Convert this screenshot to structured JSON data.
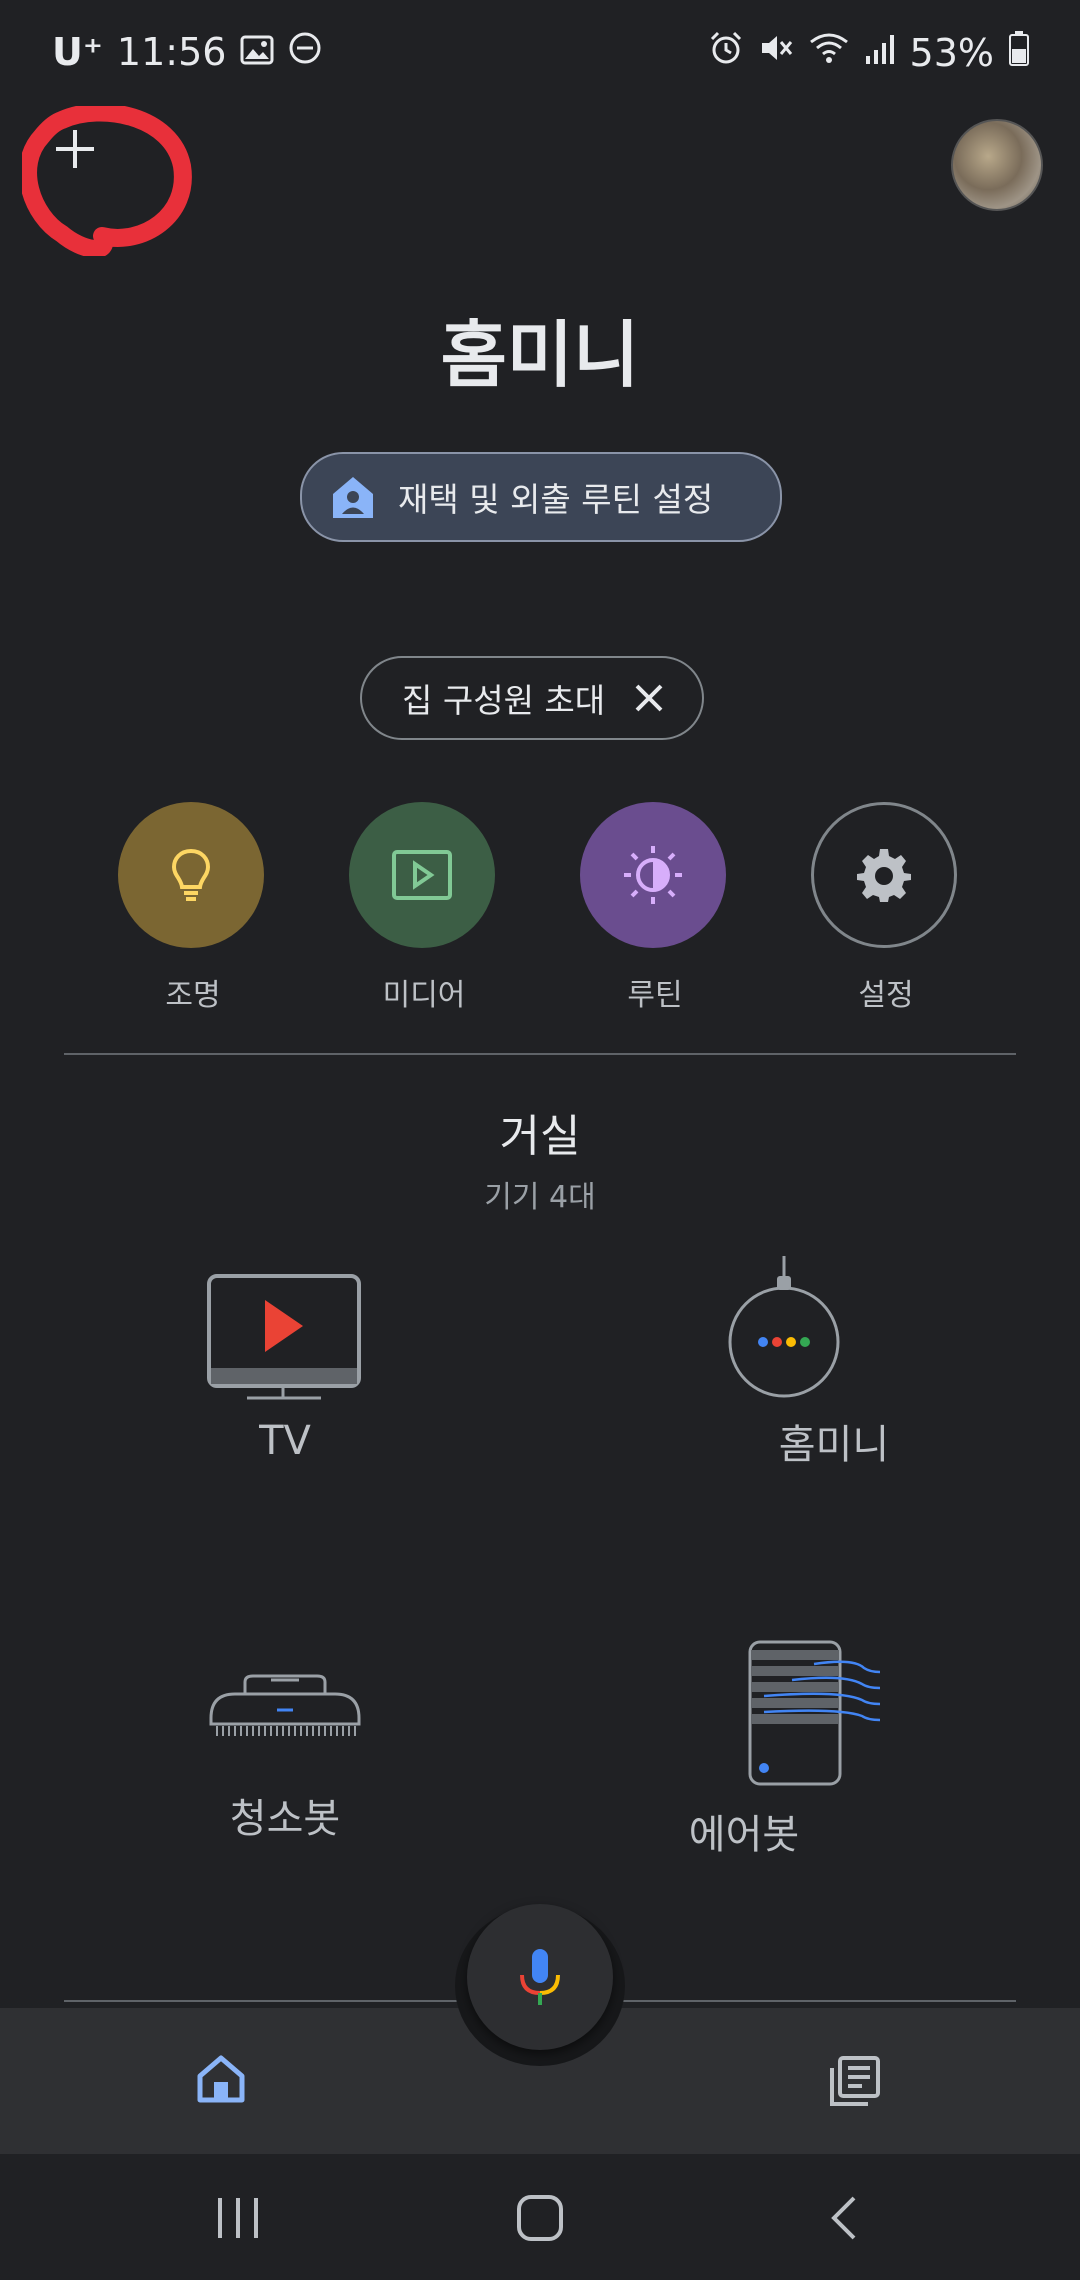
{
  "status_bar": {
    "carrier": "U⁺",
    "time": "11:56",
    "battery": "53%"
  },
  "header": {
    "home_name": "홈미니"
  },
  "routine_chip": {
    "label": "재택 및 외출 루틴 설정"
  },
  "invite_chip": {
    "label": "집 구성원 초대"
  },
  "quick_actions": [
    {
      "label": "조명",
      "icon": "lightbulb-icon",
      "color": "#7b6632"
    },
    {
      "label": "미디어",
      "icon": "media-play-icon",
      "color": "#3c5e45"
    },
    {
      "label": "루틴",
      "icon": "routine-icon",
      "color": "#6a4d8f"
    },
    {
      "label": "설정",
      "icon": "gear-icon",
      "color": "transparent"
    }
  ],
  "room": {
    "name": "거실",
    "device_count": "기기 4대",
    "devices": [
      {
        "label": "TV",
        "icon": "tv-icon"
      },
      {
        "label": "홈미니",
        "icon": "smart-speaker-icon"
      },
      {
        "label": "청소봇",
        "icon": "robot-vacuum-icon"
      },
      {
        "label": "에어봇",
        "icon": "air-purifier-icon"
      }
    ]
  },
  "bottom_nav": {
    "items": [
      "home-icon",
      "mic-icon",
      "feed-icon"
    ]
  },
  "colors": {
    "background": "#202124",
    "accent_blue": "#8ab4f8",
    "annotation_red": "#e8303a"
  }
}
